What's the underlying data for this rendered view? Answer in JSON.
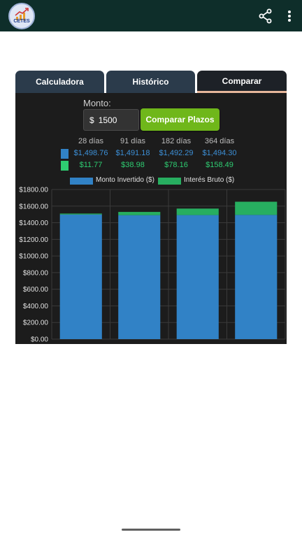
{
  "app": {
    "logo_text": "CETES",
    "icons": {
      "share": "share-icon",
      "more": "more-vert-icon"
    }
  },
  "tabs": [
    {
      "label": "Calculadora",
      "active": false
    },
    {
      "label": "Histórico",
      "active": false
    },
    {
      "label": "Comparar",
      "active": true
    }
  ],
  "form": {
    "monto_label": "Monto:",
    "currency_symbol": "$",
    "monto_value": "1500",
    "compare_button": "Comparar Plazos"
  },
  "summary": {
    "periods": [
      "28 días",
      "91 días",
      "182 días",
      "364 días"
    ],
    "invested": [
      "$1,498.76",
      "$1,491.18",
      "$1,492.29",
      "$1,494.30"
    ],
    "interest": [
      "$11.77",
      "$38.98",
      "$78.16",
      "$158.49"
    ]
  },
  "colors": {
    "invested": "#3182c6",
    "interest": "#27ae60",
    "appbar": "#0e2e2a"
  },
  "chart_data": {
    "type": "bar",
    "stacked": true,
    "categories": [
      "28 días",
      "91 días",
      "182 días",
      "364 días"
    ],
    "series": [
      {
        "name": "Monto Invertido ($)",
        "values": [
          1498.76,
          1491.18,
          1492.29,
          1494.3
        ]
      },
      {
        "name": "Interés Bruto ($)",
        "values": [
          11.77,
          38.98,
          78.16,
          158.49
        ]
      }
    ],
    "ylim": [
      0,
      1800
    ],
    "yticks": [
      "$0.00",
      "$200.00",
      "$400.00",
      "$600.00",
      "$800.00",
      "$1000.00",
      "$1200.00",
      "$1400.00",
      "$1600.00",
      "$1800.00"
    ],
    "ytick_values": [
      0,
      200,
      400,
      600,
      800,
      1000,
      1200,
      1400,
      1600,
      1800
    ],
    "grid": true,
    "legend": "top"
  }
}
